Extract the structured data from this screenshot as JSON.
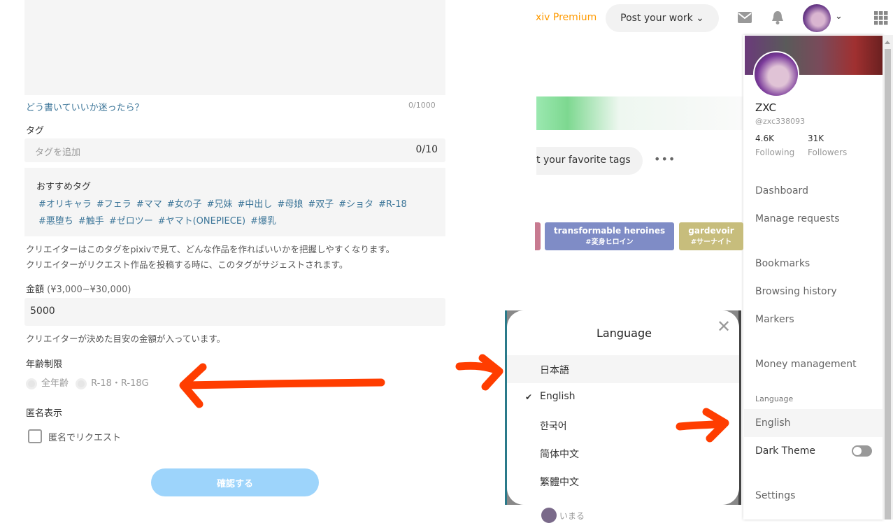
{
  "form": {
    "description_count": "0/1000",
    "help_link": "どう書いていいか迷ったら？",
    "tags_label": "タグ",
    "tags_placeholder": "タグを追加",
    "tags_count": "0/10",
    "recommended_label": "おすすめタグ",
    "recommended_tags": [
      "#オリキャラ",
      "#フェラ",
      "#ママ",
      "#女の子",
      "#兄妹",
      "#中出し",
      "#母娘",
      "#双子",
      "#ショタ",
      "#R-18",
      "#悪堕ち",
      "#触手",
      "#ゼロツー",
      "#ヤマト(ONEPIECE)",
      "#爆乳"
    ],
    "tags_note_1": "クリエイターはこのタグをpixivで見て、どんな作品を作ればいいかを把握しやすくなります。",
    "tags_note_2": "クリエイターがリクエスト作品を投稿する時に、このタグがサジェストされます。",
    "amount_label": "金額",
    "amount_range": "(¥3,000~¥30,000)",
    "amount_value": "5000",
    "amount_note": "クリエイターが決めた目安の金額が入っています。",
    "age_label": "年齢制限",
    "age_options": [
      "全年齢",
      "R-18・R-18G"
    ],
    "anon_label": "匿名表示",
    "anon_checkbox": "匿名でリクエスト",
    "confirm_button": "確認する"
  },
  "header": {
    "premium": "xiv Premium",
    "post_work": "Post your work",
    "favorite_tags": "t your favorite tags"
  },
  "tag_cards": [
    {
      "en": "transformable heroines",
      "jp": "#変身ヒロイン",
      "color": "#7f8cc6"
    },
    {
      "en": "gardevoir",
      "jp": "#サーナイト",
      "color": "#c7bd7c"
    }
  ],
  "profile": {
    "name": "ZXC",
    "handle": "@zxc338093",
    "following_count": "4.6K",
    "following_label": "Following",
    "followers_count": "31K",
    "followers_label": "Followers",
    "menu": [
      "Dashboard",
      "Manage requests",
      "Bookmarks",
      "Browsing history",
      "Markers",
      "Money management"
    ],
    "language_section": "Language",
    "language_value": "English",
    "dark_theme": "Dark Theme",
    "dark_theme_on": false,
    "settings": "Settings"
  },
  "language_modal": {
    "title": "Language",
    "options": [
      "日本語",
      "English",
      "한국어",
      "简体中文",
      "繁體中文"
    ],
    "selected": "English",
    "below_user": "いまる"
  },
  "colors": {
    "accent": "#0096fa",
    "annotation_arrow": "#ff3d00",
    "premium": "#ff9a00"
  }
}
